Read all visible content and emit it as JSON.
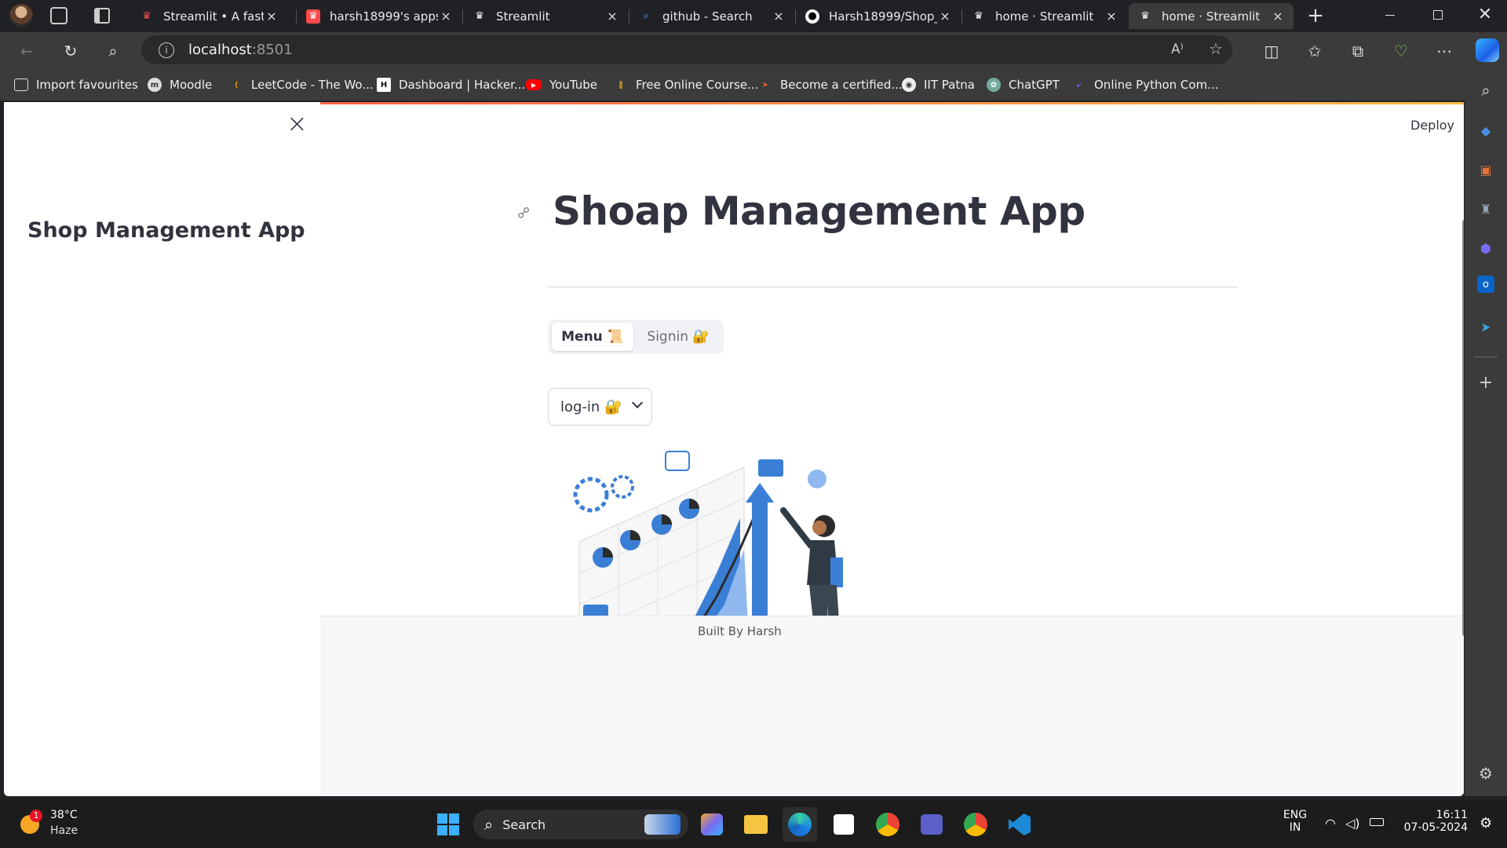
{
  "tabs": [
    {
      "title": "Streamlit • A faster way",
      "close": "×"
    },
    {
      "title": "harsh18999's apps · S",
      "close": "×"
    },
    {
      "title": "Streamlit",
      "close": "×"
    },
    {
      "title": "github - Search",
      "close": "×"
    },
    {
      "title": "Harsh18999/Shop_M",
      "close": "×"
    },
    {
      "title": "home · Streamlit",
      "close": "×"
    },
    {
      "title": "home · Streamlit",
      "close": "×"
    }
  ],
  "address": {
    "host": "localhost",
    "port": ":8501"
  },
  "bookmarks": [
    {
      "label": "Import favourites"
    },
    {
      "label": "Moodle"
    },
    {
      "label": "LeetCode - The Wo..."
    },
    {
      "label": "Dashboard | Hacker..."
    },
    {
      "label": "YouTube"
    },
    {
      "label": "Free Online Course..."
    },
    {
      "label": "Become a certified..."
    },
    {
      "label": "IIT Patna"
    },
    {
      "label": "ChatGPT"
    },
    {
      "label": "Online Python Com..."
    }
  ],
  "app": {
    "sidebar_title": "Shop Management App",
    "close_glyph": "×",
    "deploy_label": "Deploy",
    "page_title": "Shoap Management App",
    "tabs": [
      {
        "label": "Menu 📜"
      },
      {
        "label": "Signin 🔐"
      }
    ],
    "select_value": "log-in 🔐",
    "footer": "Built By Harsh"
  },
  "taskbar": {
    "weather_temp": "38°C",
    "weather_desc": "Haze",
    "weather_badge": "1",
    "search_label": "Search",
    "lang_top": "ENG",
    "lang_bottom": "IN",
    "time": "16:11",
    "date": "07-05-2024"
  },
  "colors": {
    "accent_red": "#ff4b4b",
    "illustration_blue": "#4a90e2",
    "title_text": "#31333f"
  }
}
